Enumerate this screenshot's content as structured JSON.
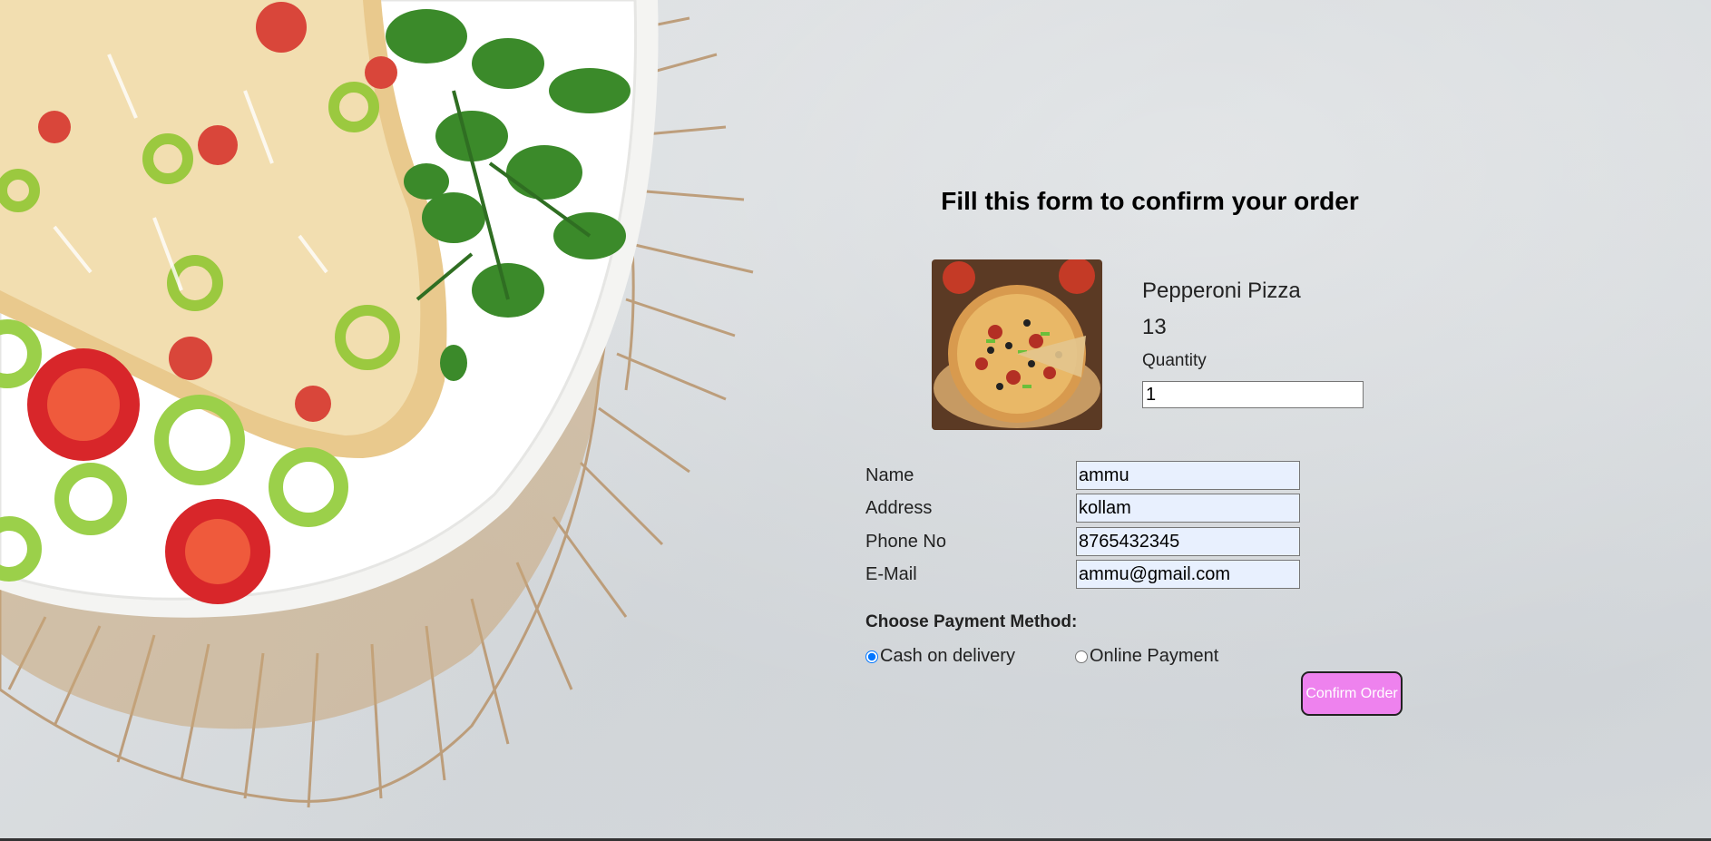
{
  "form": {
    "title": "Fill this form to confirm your order",
    "product": {
      "name": "Pepperoni Pizza",
      "price": "13",
      "quantity_label": "Quantity",
      "quantity_value": "1"
    },
    "fields": {
      "name_label": "Name",
      "name_value": "ammu",
      "address_label": "Address",
      "address_value": "kollam",
      "phone_label": "Phone No",
      "phone_value": "8765432345",
      "email_label": "E-Mail",
      "email_value": "ammu@gmail.com"
    },
    "payment": {
      "heading": "Choose Payment Method:",
      "options": [
        {
          "label": "Cash on delivery",
          "selected": true
        },
        {
          "label": "Online Payment",
          "selected": false
        }
      ]
    },
    "confirm_label": "Confirm Order"
  },
  "colors": {
    "confirm_button": "#ee82ee",
    "autofill_field": "#e8f0fe"
  }
}
